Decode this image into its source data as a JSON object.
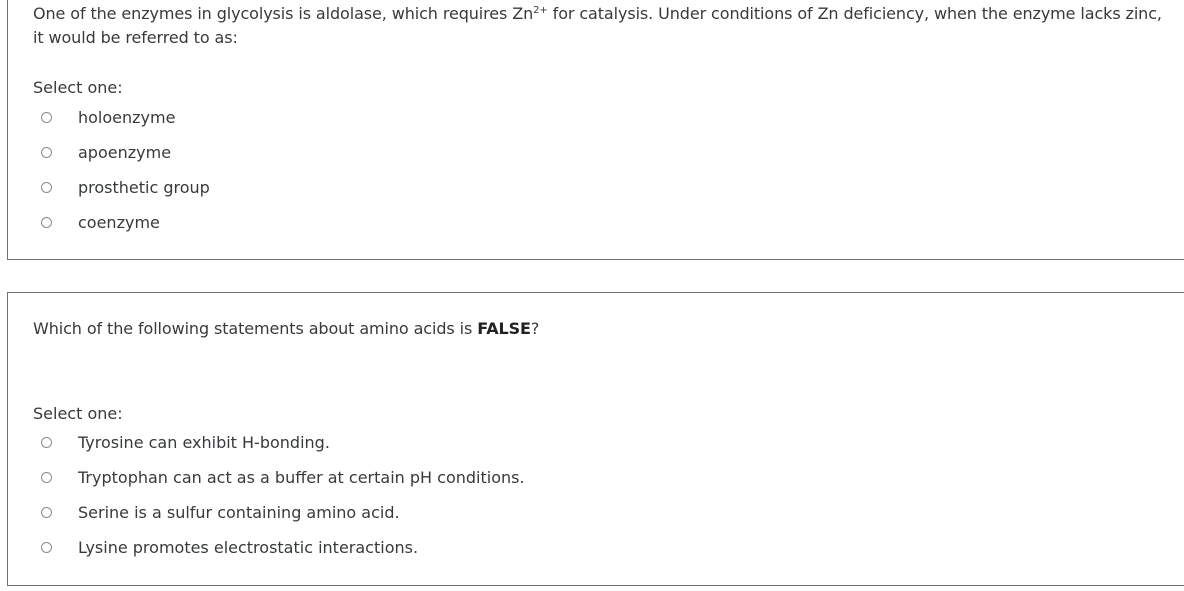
{
  "questions": [
    {
      "text_before": "One of the enzymes in glycolysis is aldolase, which requires Zn",
      "superscript": "2+",
      "text_after": " for catalysis. Under conditions of Zn deficiency, when the enzyme lacks zinc, it would be referred to as:",
      "prompt": "Select one:",
      "options": [
        "holoenzyme",
        "apoenzyme",
        "prosthetic group",
        "coenzyme"
      ],
      "selected": null
    },
    {
      "text_before": "Which of the following statements about amino acids is ",
      "emphasis": "FALSE",
      "text_after": "?",
      "prompt": "Select one:",
      "options": [
        "Tyrosine can exhibit H-bonding.",
        "Tryptophan can act as a buffer at certain pH conditions.",
        "Serine is a sulfur containing amino acid.",
        "Lysine promotes electrostatic interactions."
      ],
      "selected": null
    }
  ]
}
